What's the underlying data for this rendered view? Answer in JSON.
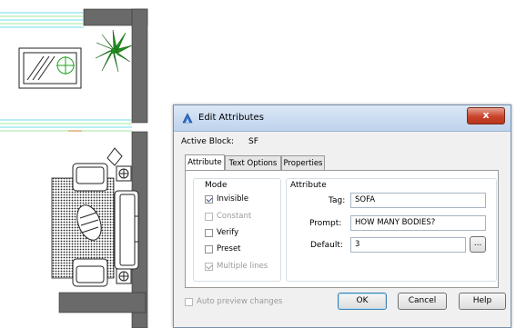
{
  "dialog": {
    "title": "Edit Attributes",
    "close_label": "x",
    "active_block_label": "Active Block:",
    "active_block_value": "SF",
    "tabs": [
      {
        "label": "Attribute",
        "active": true
      },
      {
        "label": "Text Options",
        "active": false
      },
      {
        "label": "Properties",
        "active": false
      }
    ],
    "mode": {
      "heading": "Mode",
      "options": [
        {
          "label": "Invisible",
          "checked": true,
          "enabled": true
        },
        {
          "label": "Constant",
          "checked": false,
          "enabled": false
        },
        {
          "label": "Verify",
          "checked": false,
          "enabled": true
        },
        {
          "label": "Preset",
          "checked": false,
          "enabled": true
        },
        {
          "label": "Multiple lines",
          "checked": true,
          "enabled": false
        }
      ]
    },
    "attribute": {
      "heading": "Attribute",
      "tag_label": "Tag:",
      "tag_value": "SOFA",
      "prompt_label": "Prompt:",
      "prompt_value": "HOW MANY BODIES?",
      "default_label": "Default:",
      "default_value": "3",
      "browse_label": "..."
    },
    "auto_preview": {
      "label": "Auto preview changes",
      "checked": false,
      "enabled": false
    },
    "buttons": {
      "ok": "OK",
      "cancel": "Cancel",
      "help": "Help"
    }
  },
  "colors": {
    "title_bar": "#c8daf0",
    "close_button": "#c9432a",
    "wall": "#6a6a6a",
    "plant": "#1fa31f",
    "cyan_lines": "#3fd0e0",
    "green_lines": "#7fe07f"
  }
}
